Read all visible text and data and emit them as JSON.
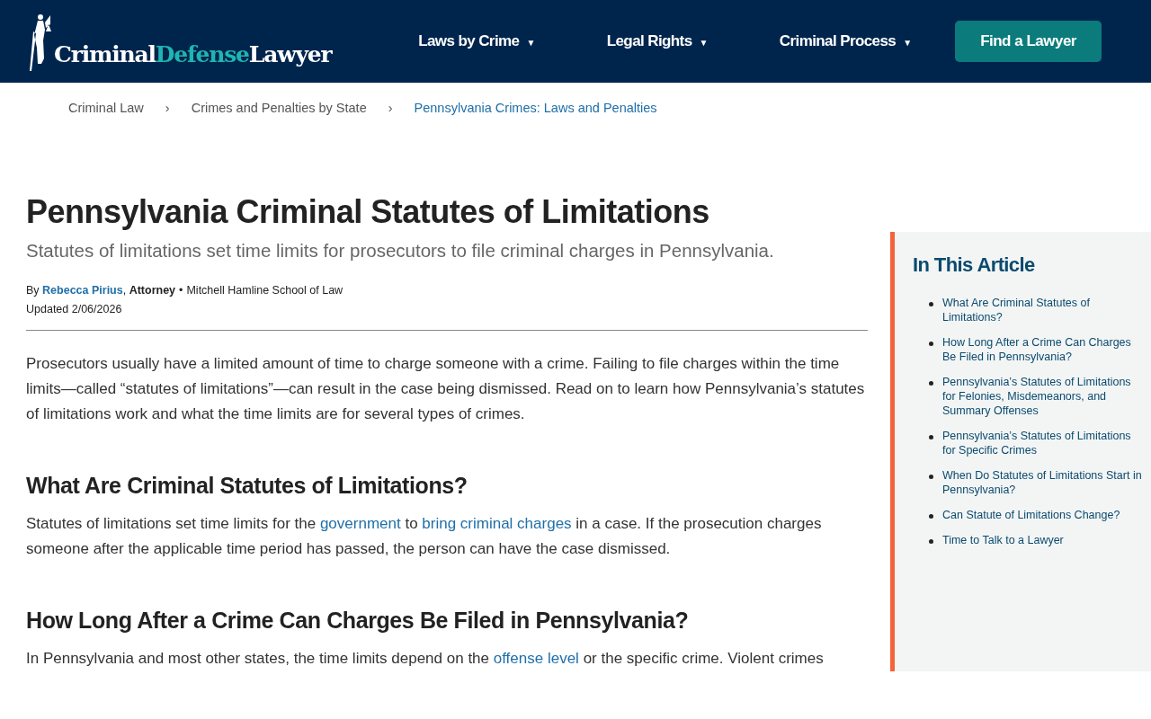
{
  "header": {
    "logo": [
      {
        "text": "Criminal",
        "accent": false
      },
      {
        "text": "Defense",
        "accent": true
      },
      {
        "text": "Lawyer",
        "accent": false
      }
    ],
    "nav": [
      {
        "label": "Laws by Crime",
        "caret": "▼"
      },
      {
        "label": "Legal Rights",
        "caret": "▼"
      },
      {
        "label": "Criminal Process",
        "caret": "▼"
      }
    ],
    "cta": "Find a Lawyer"
  },
  "breadcrumb": {
    "items": [
      {
        "label": "Criminal Law",
        "current": false
      },
      {
        "label": "Crimes and Penalties by State",
        "current": false
      },
      {
        "label": "Pennsylvania Crimes: Laws and Penalties",
        "current": true
      }
    ],
    "separator": "›"
  },
  "article": {
    "title": "Pennsylvania Criminal Statutes of Limitations",
    "subtitle": "Statutes of limitations set time limits for prosecutors to file criminal charges in Pennsylvania.",
    "byline": {
      "prefix": "By",
      "author": "Rebecca Pirius",
      "role": ", **Attorney**",
      "dot": "•",
      "school": "Mitchell Hamline School of Law",
      "updated": "Updated 2/06/2026"
    },
    "blocks": [
      {
        "kind": "paragraph",
        "segments": [
          {
            "text": "Prosecutors usually have a limited amount of time to charge someone with a crime. Failing to file charges within the time limits—called “statutes of limitations”—can result in the case being dismissed. Read on to learn how Pennsylvania’s statutes of limitations work and what the time limits are for several types of crimes.",
            "link": false
          }
        ]
      },
      {
        "kind": "heading",
        "text": "What Are Criminal Statutes of Limitations?"
      },
      {
        "kind": "paragraph",
        "segments": [
          {
            "text": "Statutes of limitations set time limits for the ",
            "link": false
          },
          {
            "text": "government",
            "link": true
          },
          {
            "text": " to ",
            "link": false
          },
          {
            "text": "bring criminal charges",
            "link": true
          },
          {
            "text": " in a case. If the prosecution charges someone after the applicable time period has passed, the person can have the case dismissed.",
            "link": false
          }
        ]
      },
      {
        "kind": "heading",
        "text": "How Long After a Crime Can Charges Be Filed in Pennsylvania?"
      },
      {
        "kind": "paragraph",
        "segments": [
          {
            "text": "In Pennsylvania and most other states, the time limits depend on the ",
            "link": false
          },
          {
            "text": "offense level",
            "link": true
          },
          {
            "text": " or the specific crime. Violent crimes",
            "link": false
          }
        ]
      }
    ]
  },
  "toc": {
    "title": "In This Article",
    "items": [
      "What Are Criminal Statutes of Limitations?",
      "How Long After a Crime Can Charges Be Filed in Pennsylvania?",
      "Pennsylvania’s Statutes of Limitations for Felonies, Misdemeanors, and Summary Offenses",
      "Pennsylvania’s Statutes of Limitations for Specific Crimes",
      "When Do Statutes of Limitations Start in Pennsylvania?",
      "Can Statute of Limitations Change?",
      "Time to Talk to a Lawyer"
    ]
  }
}
